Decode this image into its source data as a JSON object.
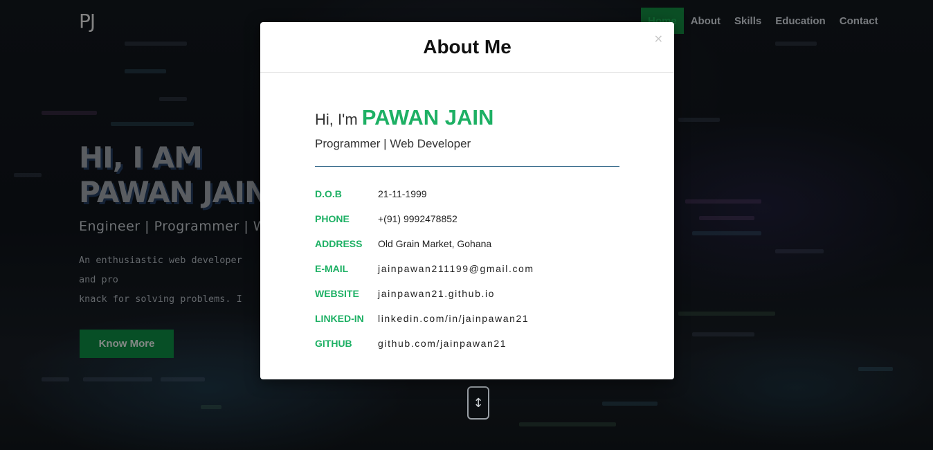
{
  "header": {
    "logo": "PJ",
    "nav": [
      "Home",
      "About",
      "Skills",
      "Education",
      "Contact"
    ],
    "active_nav": "Home"
  },
  "hero": {
    "title_line1": "HI, I AM",
    "title_line2": "PAWAN JAIN",
    "subtitle": "Engineer | Programmer | Web",
    "description": "An enthusiastic web developer and pro\nknack for solving problems. I try to get\nthat tickles my curiosity and learn abo",
    "button_label": "Know More"
  },
  "modal": {
    "title": "About Me",
    "close_glyph": "×",
    "greeting_prefix": "Hi, I'm",
    "name": "PAWAN JAIN",
    "role": "Programmer | Web Developer",
    "info": [
      {
        "label": "D.O.B",
        "value": "21-11-1999"
      },
      {
        "label": "PHONE",
        "value": "+(91) 9992478852"
      },
      {
        "label": "ADDRESS",
        "value": "Old Grain Market, Gohana"
      },
      {
        "label": "E-MAIL",
        "value": "jainpawan211199@gmail.com"
      },
      {
        "label": "WEBSITE",
        "value": "jainpawan21.github.io"
      },
      {
        "label": "LINKED-IN",
        "value": "linkedin.com/in/jainpawan21"
      },
      {
        "label": "GITHUB",
        "value": "github.com/jainpawan21"
      }
    ]
  },
  "scroll_button": {
    "icon": "up-down-arrow-icon",
    "glyph": "↕"
  },
  "colors": {
    "accent_green": "#1db064",
    "button_green": "#0b7a3b",
    "nav_active_bg": "#127a3a"
  }
}
